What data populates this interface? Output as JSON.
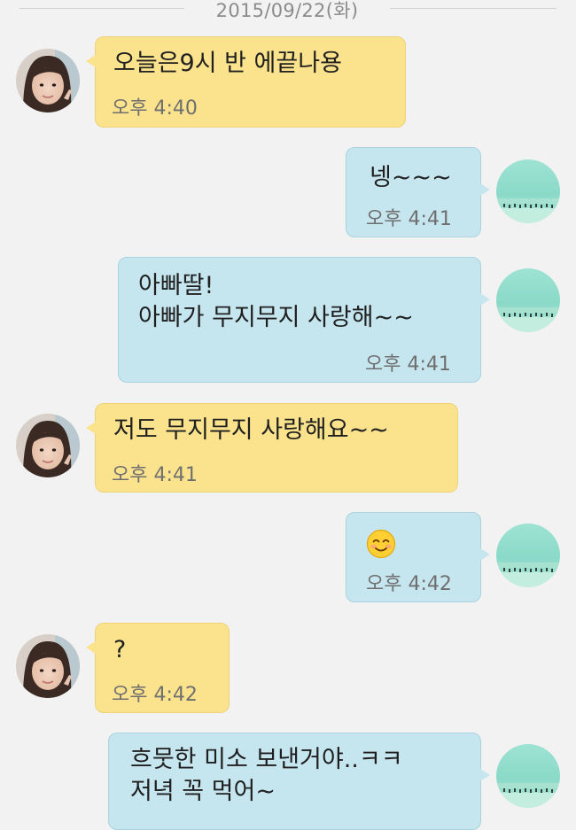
{
  "date_divider": "2015/09/22(화)",
  "messages": [
    {
      "text": "오늘은9시 반 에끝나용",
      "time": "오후 4:40"
    },
    {
      "text": "넹~~~",
      "time": "오후 4:41"
    },
    {
      "text": "아빠딸!\n아빠가 무지무지 사랑해~~",
      "time": "오후 4:41"
    },
    {
      "text": "저도 무지무지 사랑해요~~",
      "time": "오후 4:41"
    },
    {
      "text": "",
      "emoji": "smiling-face-icon",
      "time": "오후 4:42"
    },
    {
      "text": "?",
      "time": "오후 4:42"
    },
    {
      "text": "흐뭇한 미소 보낸거야..ㅋㅋ\n저녁 꼭 먹어~",
      "time": ""
    }
  ],
  "colors": {
    "background": "#f2f2f2",
    "incoming_bubble": "#fbe38d",
    "outgoing_bubble": "#c6e6ef",
    "time_text": "#6f6f6f"
  }
}
